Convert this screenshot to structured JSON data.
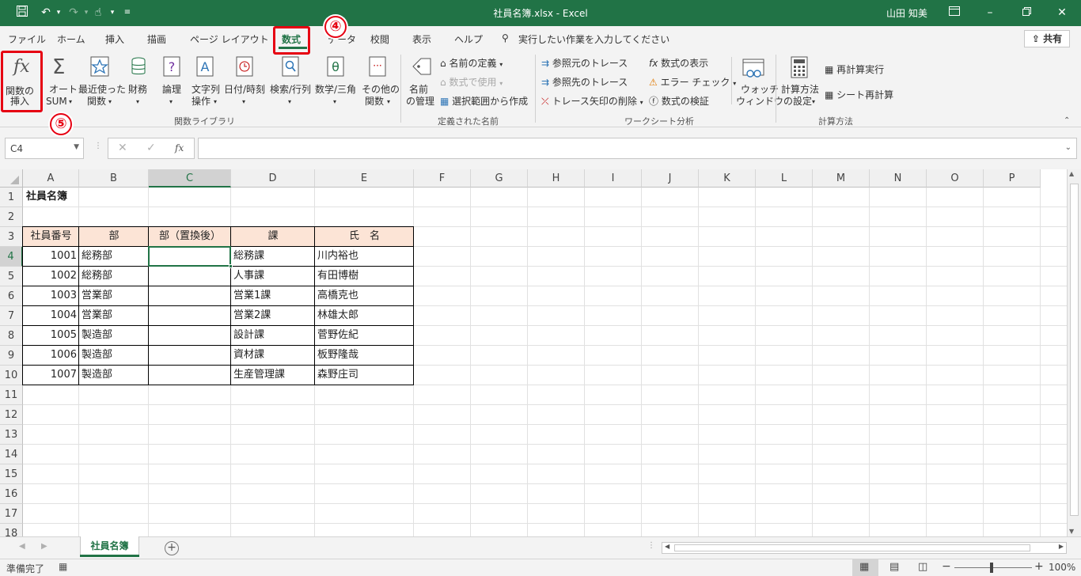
{
  "titlebar": {
    "doc_title": "社員名簿.xlsx  -  Excel",
    "user": "山田 知美"
  },
  "tabs": [
    "ファイル",
    "ホーム",
    "挿入",
    "描画",
    "ページ レイアウト",
    "数式",
    "データ",
    "校閲",
    "表示",
    "ヘルプ"
  ],
  "tell_me": "実行したい作業を入力してください",
  "share": "共有",
  "ribbon": {
    "insert_function": [
      "関数の",
      "挿入"
    ],
    "autosum": [
      "オート",
      "SUM"
    ],
    "recent": [
      "最近使った",
      "関数"
    ],
    "financial": "財務",
    "logical": "論理",
    "text": [
      "文字列",
      "操作"
    ],
    "datetime": "日付/時刻",
    "lookup": "検索/行列",
    "math": "数学/三角",
    "more": [
      "その他の",
      "関数"
    ],
    "group_library": "関数ライブラリ",
    "name_manager": [
      "名前",
      "の管理"
    ],
    "define_name": "名前の定義",
    "use_in_formula": "数式で使用",
    "create_from_selection": "選択範囲から作成",
    "group_names": "定義された名前",
    "trace_precedents": "参照元のトレース",
    "trace_dependents": "参照先のトレース",
    "remove_arrows": "トレース矢印の削除",
    "show_formulas": "数式の表示",
    "error_checking": "エラー チェック",
    "evaluate": "数式の検証",
    "watch": [
      "ウォッチ",
      "ウィンドウ"
    ],
    "group_audit": "ワークシート分析",
    "calc_options": [
      "計算方法",
      "の設定"
    ],
    "calc_now": "再計算実行",
    "calc_sheet": "シート再計算",
    "group_calc": "計算方法"
  },
  "namebox": "C4",
  "fx": "fx",
  "columns": [
    "A",
    "B",
    "C",
    "D",
    "E",
    "F",
    "G",
    "H",
    "I",
    "J",
    "K",
    "L",
    "M",
    "N",
    "O",
    "P"
  ],
  "rows": [
    "1",
    "2",
    "3",
    "4",
    "5",
    "6",
    "7",
    "8",
    "9",
    "10",
    "11",
    "12",
    "13",
    "14",
    "15",
    "16",
    "17",
    "18"
  ],
  "sheet": {
    "title": "社員名簿",
    "headers": [
      "社員番号",
      "部",
      "部（置換後）",
      "課",
      "氏　名"
    ],
    "records": [
      {
        "no": "1001",
        "dept": "総務部",
        "new": "",
        "sec": "総務課",
        "name": "川内裕也"
      },
      {
        "no": "1002",
        "dept": "総務部",
        "new": "",
        "sec": "人事課",
        "name": "有田博樹"
      },
      {
        "no": "1003",
        "dept": "営業部",
        "new": "",
        "sec": "営業1課",
        "name": "高橋克也"
      },
      {
        "no": "1004",
        "dept": "営業部",
        "new": "",
        "sec": "営業2課",
        "name": "林雄太郎"
      },
      {
        "no": "1005",
        "dept": "製造部",
        "new": "",
        "sec": "設計課",
        "name": "菅野佐紀"
      },
      {
        "no": "1006",
        "dept": "製造部",
        "new": "",
        "sec": "資材課",
        "name": "板野隆哉"
      },
      {
        "no": "1007",
        "dept": "製造部",
        "new": "",
        "sec": "生産管理課",
        "name": "森野庄司"
      }
    ]
  },
  "sheet_tab": "社員名簿",
  "status": "準備完了",
  "zoom": "100%",
  "callouts": [
    "④",
    "⑤"
  ],
  "colors": {
    "excel_green": "#217346",
    "highlight_red": "#e60012",
    "header_fill": "#fce4d6"
  }
}
